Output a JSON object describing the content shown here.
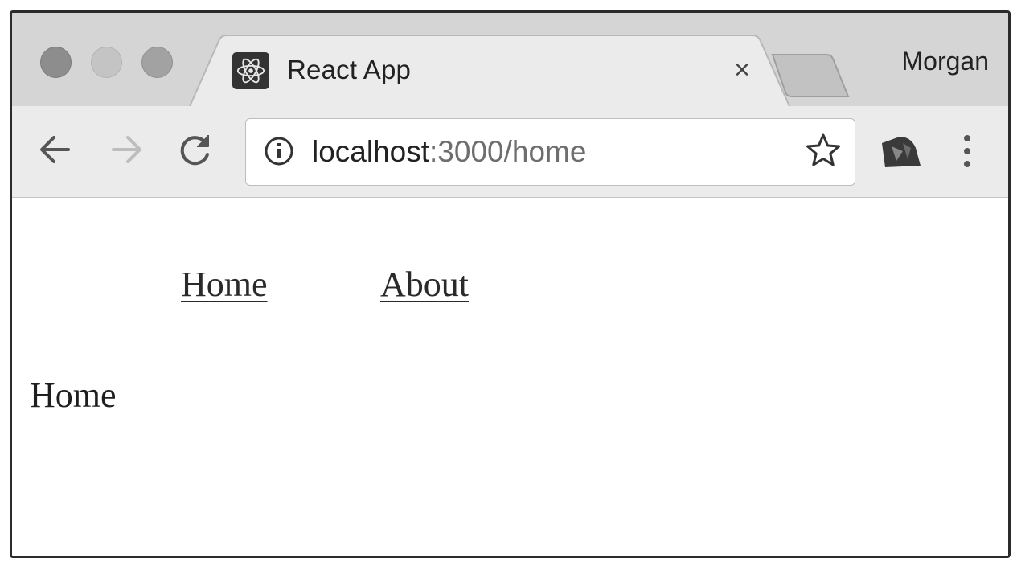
{
  "window": {
    "tab": {
      "title": "React App",
      "close_glyph": "×",
      "favicon": "react-logo-icon"
    },
    "profile_name": "Morgan"
  },
  "toolbar": {
    "url_host": "localhost",
    "url_rest": ":3000/home",
    "icons": [
      "back-arrow-icon",
      "forward-arrow-icon",
      "reload-icon",
      "info-icon",
      "star-icon",
      "extension-icon",
      "menu-icon"
    ]
  },
  "page": {
    "nav": [
      {
        "label": "Home"
      },
      {
        "label": "About"
      }
    ],
    "heading": "Home"
  }
}
